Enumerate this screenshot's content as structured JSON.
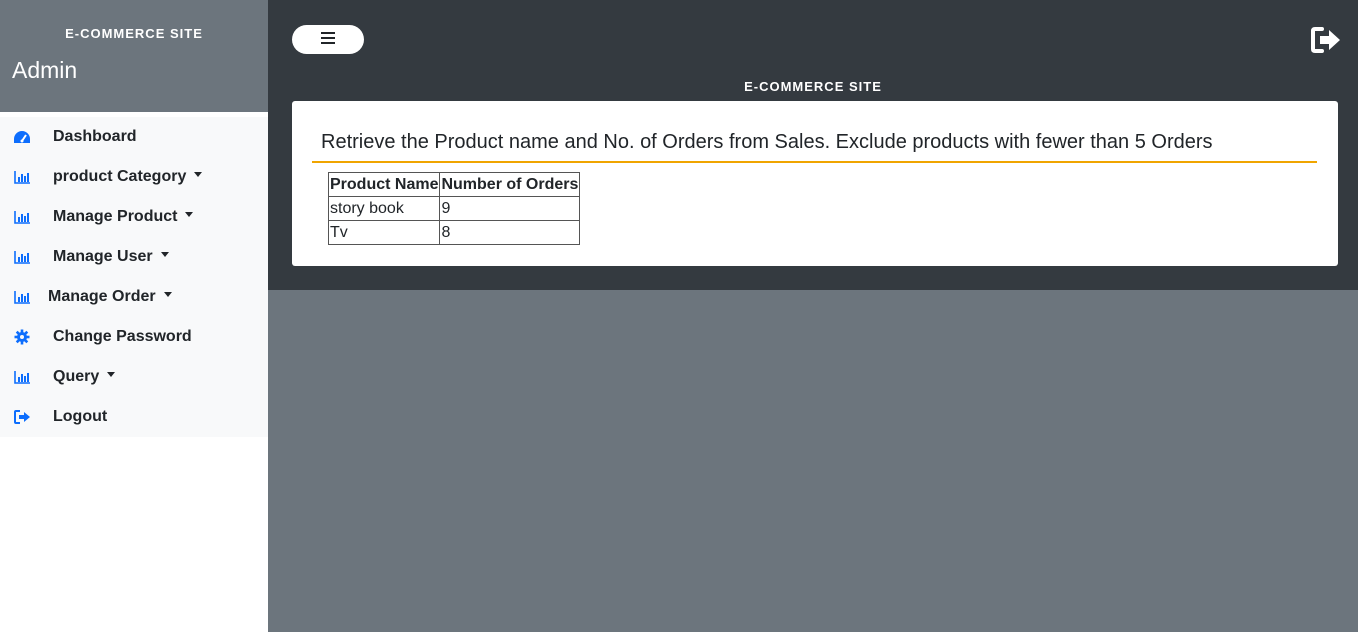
{
  "sidebar": {
    "brand": "E-COMMERCE SITE",
    "user": "Admin",
    "items": [
      {
        "label": "Dashboard",
        "icon": "dashboard-icon",
        "dropdown": false
      },
      {
        "label": "product Category",
        "icon": "bar-chart-icon",
        "dropdown": true
      },
      {
        "label": "Manage Product",
        "icon": "bar-chart-icon",
        "dropdown": true
      },
      {
        "label": "Manage User",
        "icon": "bar-chart-icon",
        "dropdown": true
      },
      {
        "label": "Manage Order",
        "icon": "bar-chart-icon",
        "dropdown": true
      },
      {
        "label": "Change Password",
        "icon": "gear-icon",
        "dropdown": false
      },
      {
        "label": "Query",
        "icon": "bar-chart-icon",
        "dropdown": true
      },
      {
        "label": "Logout",
        "icon": "sign-out-icon",
        "dropdown": false
      }
    ]
  },
  "header": {
    "brand": "E-COMMERCE SITE",
    "toggle_icon": "hamburger-icon",
    "logout_icon": "sign-out-icon"
  },
  "main": {
    "title": "Retrieve the Product name and No. of Orders from Sales. Exclude products with fewer than 5 Orders",
    "table": {
      "headers": [
        "Product Name",
        "Number of Orders"
      ],
      "rows": [
        [
          "story book",
          "9"
        ],
        [
          "Tv",
          "8"
        ]
      ]
    }
  },
  "colors": {
    "accent": "#0d6efd",
    "rule": "#f0a500",
    "topbar": "#343a40",
    "sidebar_header": "#6c757d"
  }
}
